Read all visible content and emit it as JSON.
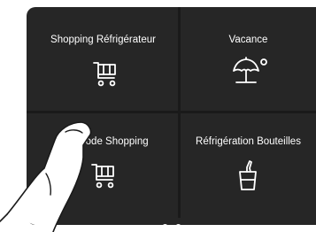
{
  "tiles": [
    {
      "label": "Shopping Réfrigérateur",
      "icon": "shopping-cart-icon"
    },
    {
      "label": "Vacance",
      "icon": "beach-umbrella-sun-icon"
    },
    {
      "label": "FlexMode Shopping",
      "icon": "shopping-cart-icon"
    },
    {
      "label": "Réfrigération Bouteilles",
      "icon": "bottle-ice-bucket-icon"
    }
  ],
  "pagination": {
    "current_page": 1,
    "total_pages": 2
  },
  "colors": {
    "screen_bg": "#262626",
    "divider": "#1a1a1a",
    "text": "#ffffff"
  }
}
